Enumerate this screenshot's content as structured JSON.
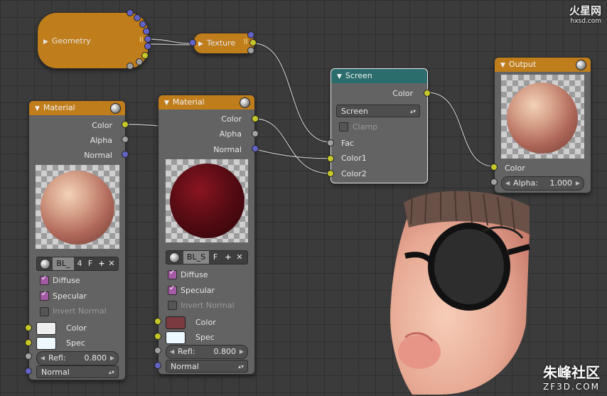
{
  "nodes": {
    "geometry": {
      "title": "Geometry"
    },
    "texture": {
      "title": "Texture"
    },
    "screen": {
      "title": "Screen",
      "output_color": "Color",
      "blend_mode": "Screen",
      "clamp_label": "Clamp",
      "fac_label": "Fac",
      "color1_label": "Color1",
      "color2_label": "Color2"
    },
    "output": {
      "title": "Output",
      "color_label": "Color",
      "alpha_label": "Alpha:",
      "alpha_value": "1.000"
    },
    "material1": {
      "title": "Material",
      "outputs": {
        "color": "Color",
        "alpha": "Alpha",
        "normal": "Normal"
      },
      "mat_name": "BL_",
      "mat_users": "4",
      "fake_label": "F",
      "diffuse_label": "Diffuse",
      "specular_label": "Specular",
      "invert_normal_label": "Invert Normal",
      "color_label": "Color",
      "spec_label": "Spec",
      "refl_label": "Refl:",
      "refl_value": "0.800",
      "normal_input": "Normal",
      "color_swatch": "#eeeeee",
      "spec_swatch": "#eef8ff"
    },
    "material2": {
      "title": "Material",
      "outputs": {
        "color": "Color",
        "alpha": "Alpha",
        "normal": "Normal"
      },
      "mat_name": "BL_S",
      "fake_label": "F",
      "diffuse_label": "Diffuse",
      "specular_label": "Specular",
      "invert_normal_label": "Invert Normal",
      "color_label": "Color",
      "spec_label": "Spec",
      "refl_label": "Refl:",
      "refl_value": "0.800",
      "normal_input": "Normal",
      "color_swatch": "#7a3a40",
      "spec_swatch": "#eef8ff"
    }
  },
  "watermarks": {
    "top": "火星网",
    "top_url": "hxsd.com",
    "bottom": "朱峰社区",
    "bottom_url": "ZF3D.COM"
  },
  "colors": {
    "header_orange": "#c07d1b",
    "header_teal": "#2b6d6d",
    "socket_yellow": "#c7c729",
    "socket_gray": "#a1a1a1",
    "socket_blue": "#6363c7",
    "checkbox_on": "#a55aa5"
  },
  "icons": [
    "triangle-down-icon",
    "triangle-right-icon",
    "material-sphere-icon",
    "plus-icon",
    "close-icon",
    "checkmark-icon"
  ]
}
